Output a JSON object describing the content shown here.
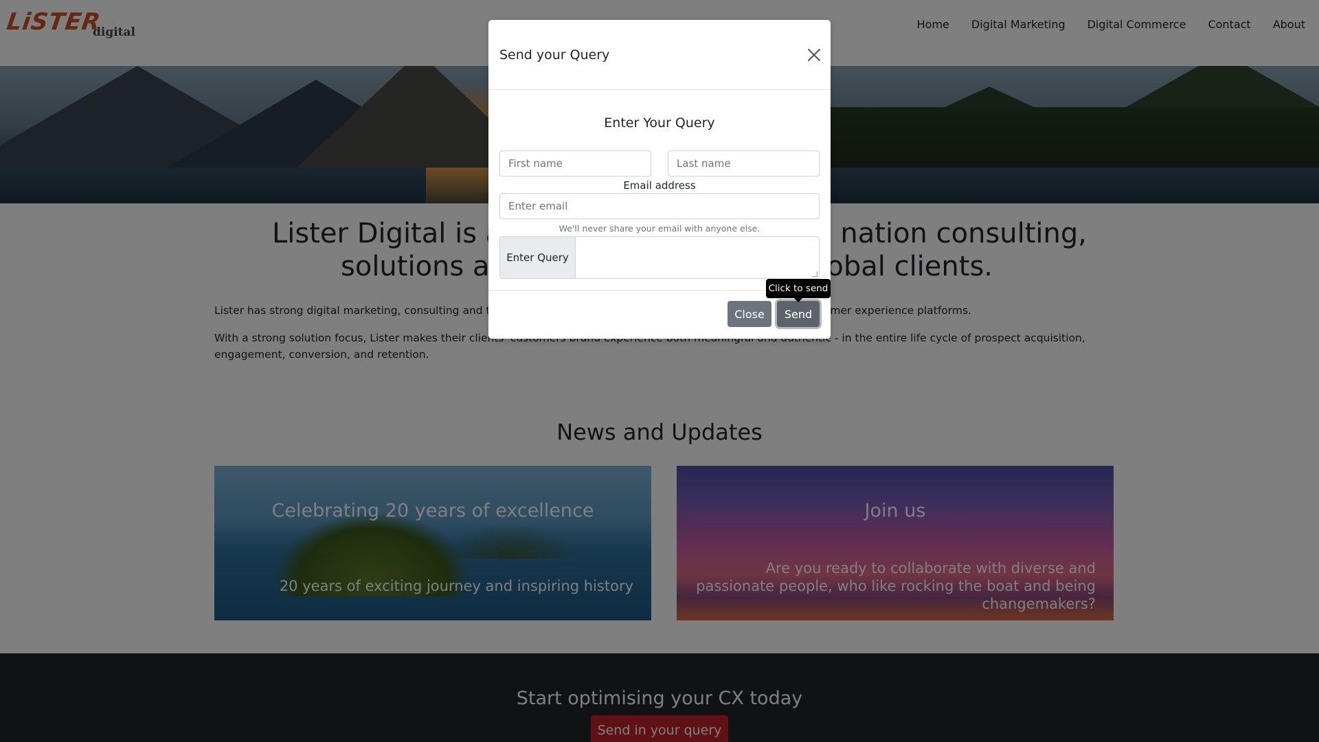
{
  "brand": {
    "name": "LiSTER",
    "sub": "digital"
  },
  "nav": {
    "items": [
      "Home",
      "Digital Marketing",
      "Digital Commerce",
      "Contact",
      "About"
    ]
  },
  "intro": {
    "headline": "Lister Digital is a t... ...ation consulting, solutions an... ...obal clients.",
    "headline_line1_left": "Lister Digital is a t",
    "headline_line1_right": "nation consulting,",
    "headline_line2_left": "solutions an",
    "headline_line2_right": "obal clients.",
    "para1_left": "Lister has strong digital marketing, consulting and techn",
    "para1_right": "stomer experience platforms.",
    "para2": "With a strong solution focus, Lister makes their clients' customers brand experience both meaningful and authentic - in the entire life cycle of prospect acquisition, engagement, conversion, and retention."
  },
  "news": {
    "title": "News and Updates",
    "cards": [
      {
        "title": "Celebrating 20 years of excellence",
        "text": "20 years of exciting journey and inspiring history"
      },
      {
        "title": "Join us",
        "text": "Are you ready to collaborate with diverse and passionate people, who like rocking the boat and being changemakers?"
      }
    ]
  },
  "footer": {
    "title": "Start optimising your CX today",
    "button": "Send in your query"
  },
  "modal": {
    "title": "Send your Query",
    "heading": "Enter Your Query",
    "first_name_placeholder": "First name",
    "last_name_placeholder": "Last name",
    "email_label": "Email address",
    "email_placeholder": "Enter email",
    "email_help": "We'll never share your email with anyone else.",
    "query_label": "Enter Query",
    "close_button": "Close",
    "send_button": "Send",
    "tooltip": "Click to send"
  }
}
